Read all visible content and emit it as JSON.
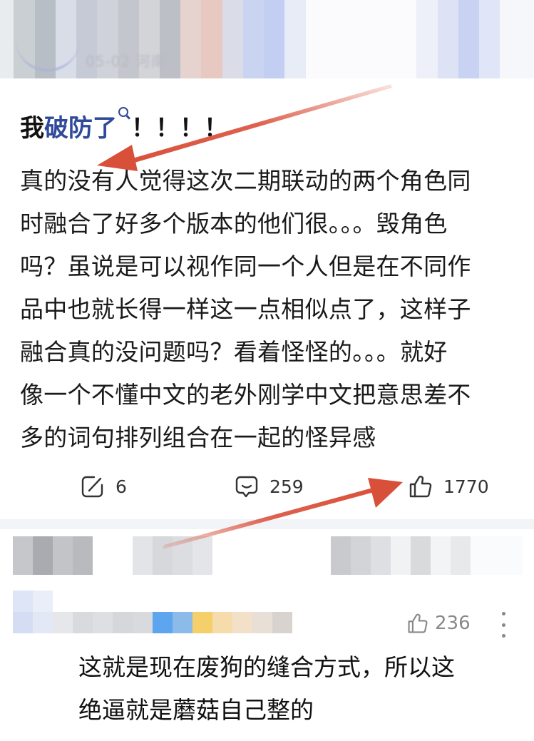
{
  "header": {
    "timestamp_text": "05-02 河南"
  },
  "post": {
    "title_prefix": "我",
    "title_link": "破防了",
    "title_suffix": "！！！！",
    "body": "真的没有人觉得这次二期联动的两个角色同\n时融合了好多个版本的他们很。。。毁角色\n吗？虽说是可以视作同一个人但是在不同作\n品中也就长得一样这一点相似点了，这样子\n融合真的没问题吗？看着怪怪的。。。就好\n像一个不懂中文的老外刚学中文把意思差不\n多的词句排列组合在一起的怪异感"
  },
  "actions": {
    "repost": {
      "icon": "repost-icon",
      "count": "6"
    },
    "comment": {
      "icon": "comment-icon",
      "count": "259"
    },
    "like": {
      "icon": "thumbs-up-icon",
      "count": "1770"
    }
  },
  "comment": {
    "like_count": "236",
    "text": "这就是现在废狗的缝合方式，所以这\n绝逼就是蘑菇自己整的"
  },
  "colors": {
    "link": "#2f4a9a",
    "arrow": "#d9503a",
    "icon": "#333333"
  }
}
